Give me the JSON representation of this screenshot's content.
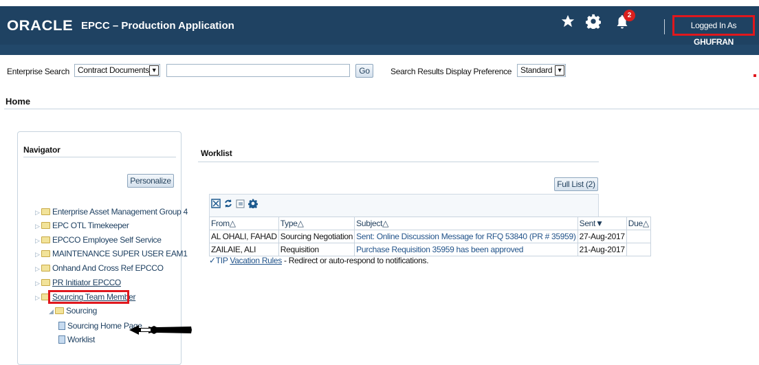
{
  "header": {
    "logo": "ORACLE",
    "app_title": "EPCC – Production Application",
    "star_icon": "favorites-star-icon",
    "gear_icon": "settings-gear-icon",
    "bell_icon": "notifications-bell-icon",
    "notification_count": "2",
    "logged_in_label": "Logged In As",
    "logged_in_user": "GHUFRAN"
  },
  "search": {
    "label": "Enterprise Search",
    "category_value": "Contract Documents",
    "query_value": "",
    "go_label": "Go",
    "pref_label": "Search Results Display Preference",
    "pref_value": "Standard"
  },
  "page": {
    "title": "Home"
  },
  "navigator": {
    "title": "Navigator",
    "personalize_label": "Personalize",
    "items": [
      {
        "label": "Enterprise Asset Management Group 4"
      },
      {
        "label": "EPC OTL Timekeeper"
      },
      {
        "label": "EPCCO Employee Self Service"
      },
      {
        "label": "MAINTENANCE SUPER USER EAM1"
      },
      {
        "label": "Onhand And Cross Ref EPCCO"
      },
      {
        "label": "PR Initiator EPCCO"
      },
      {
        "label": "Sourcing Team Member"
      }
    ],
    "sub_folder": "Sourcing",
    "pages": [
      {
        "label": "Sourcing Home Page"
      },
      {
        "label": "Worklist"
      }
    ]
  },
  "worklist": {
    "title": "Worklist",
    "full_list_label": "Full List (2)",
    "columns": [
      "From",
      "Type",
      "Subject",
      "Sent",
      "Due"
    ],
    "rows": [
      {
        "from": "AL OHALI, FAHAD",
        "type": "Sourcing Negotiation",
        "subject": "Sent: Online Discussion Message for RFQ 53840 (PR # 35959)",
        "sent": "27-Aug-2017",
        "due": ""
      },
      {
        "from": "ZAILAIE, ALI",
        "type": "Requisition",
        "subject": "Purchase Requisition 35959 has been approved",
        "sent": "21-Aug-2017",
        "due": ""
      }
    ],
    "tip_label": "TIP",
    "tip_link": "Vacation Rules",
    "tip_text": " - Redirect or auto-respond to notifications."
  },
  "colors": {
    "header_bg": "#1f4262",
    "highlight_red": "#e0171d",
    "link_blue": "#21538a"
  }
}
